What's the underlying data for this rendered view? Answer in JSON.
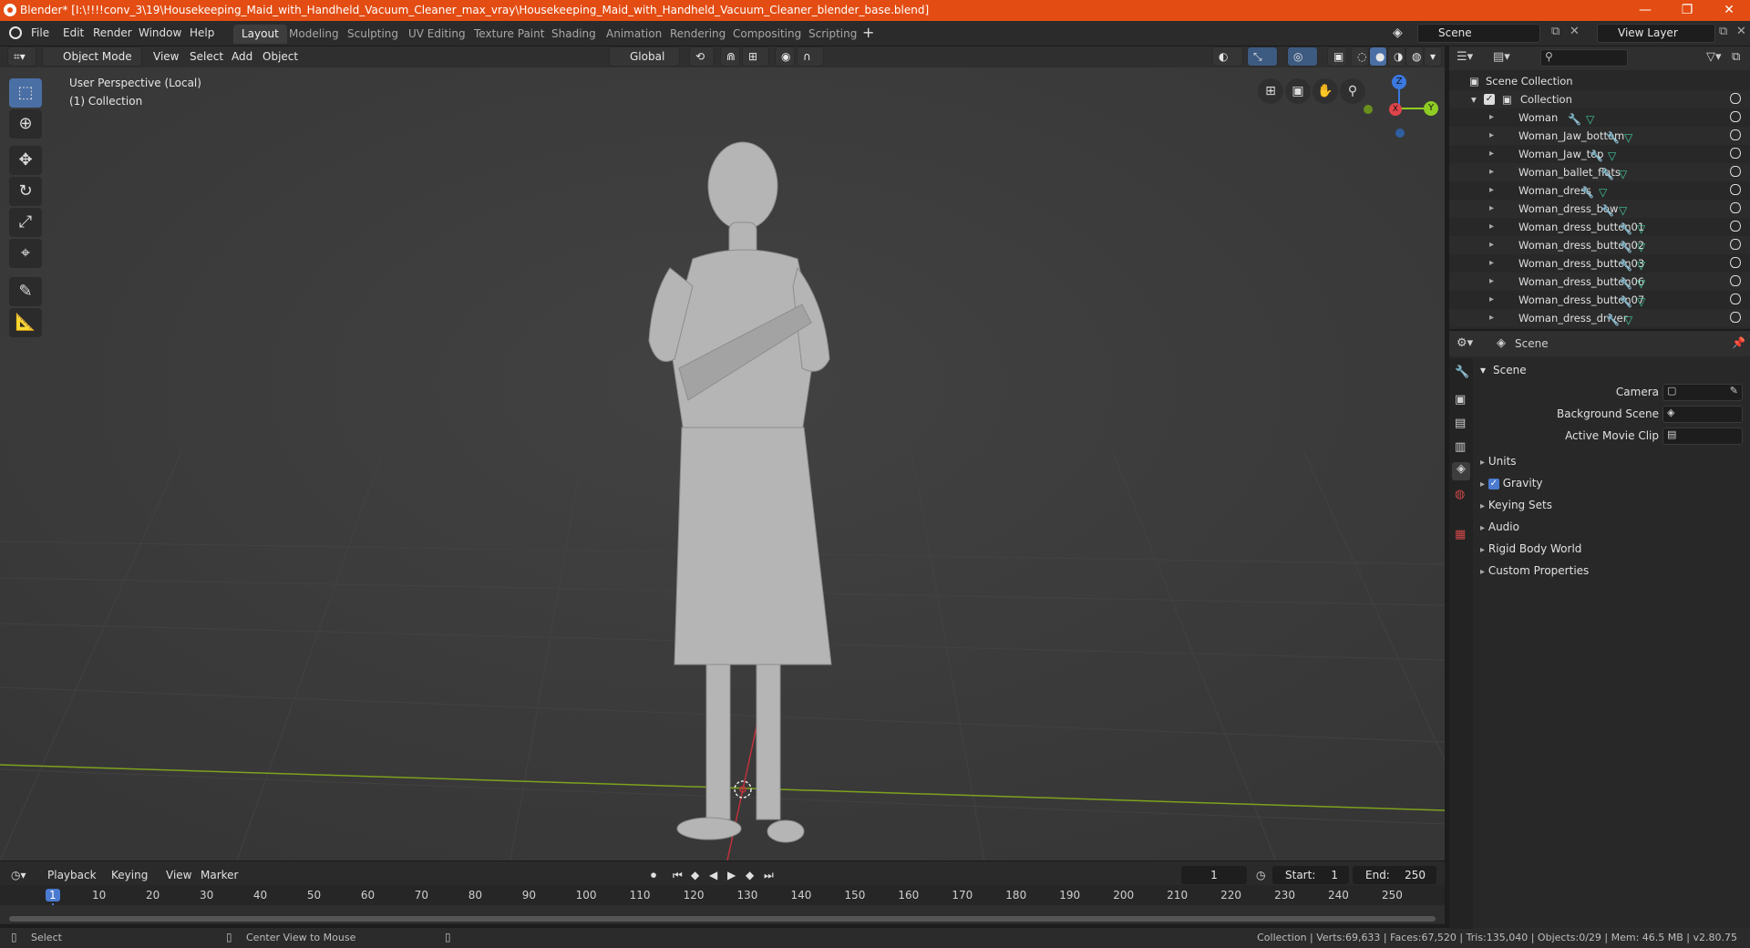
{
  "title_bar": {
    "title": "Blender* [I:\\!!!!conv_3\\19\\Housekeeping_Maid_with_Handheld_Vacuum_Cleaner_max_vray\\Housekeeping_Maid_with_Handheld_Vacuum_Cleaner_blender_base.blend]",
    "controls": [
      "—",
      "❐",
      "✕"
    ]
  },
  "menu_bar": {
    "menus": [
      "File",
      "Edit",
      "Render",
      "Window",
      "Help"
    ],
    "workspaces": [
      "Layout",
      "Modeling",
      "Sculpting",
      "UV Editing",
      "Texture Paint",
      "Shading",
      "Animation",
      "Rendering",
      "Compositing",
      "Scripting"
    ],
    "active_workspace": "Layout",
    "add_tab": "+",
    "scene": "Scene",
    "view_layer": "View Layer"
  },
  "viewport_header": {
    "mode": "Object Mode",
    "menus": [
      "View",
      "Select",
      "Add",
      "Object"
    ],
    "orientation": "Global"
  },
  "viewport": {
    "perspective_label": "User Perspective (Local)",
    "collection_label": "(1) Collection",
    "gizmo": {
      "z": "Z",
      "y": "Y",
      "x": "X"
    }
  },
  "timeline": {
    "menus": [
      "Playback",
      "Keying",
      "View",
      "Marker"
    ],
    "current_frame": "1",
    "start_label": "Start:",
    "start": "1",
    "end_label": "End:",
    "end": "250",
    "ticks": [
      "1",
      "10",
      "20",
      "30",
      "40",
      "50",
      "60",
      "70",
      "80",
      "90",
      "100",
      "110",
      "120",
      "130",
      "140",
      "150",
      "160",
      "170",
      "180",
      "190",
      "200",
      "210",
      "220",
      "230",
      "240",
      "250"
    ]
  },
  "status_bar": {
    "left_action": "Select",
    "middle_action": "Center View to Mouse",
    "stats": "Collection | Verts:69,633 | Faces:67,520 | Tris:135,040 | Objects:0/29 | Mem: 46.5 MB | v2.80.75"
  },
  "outliner": {
    "root": "Scene Collection",
    "collection": "Collection",
    "items": [
      "Woman",
      "Woman_Jaw_bottom",
      "Woman_Jaw_top",
      "Woman_ballet_flats",
      "Woman_dress",
      "Woman_dress_bow",
      "Woman_dress_button01",
      "Woman_dress_button02",
      "Woman_dress_button03",
      "Woman_dress_button06",
      "Woman_dress_button07",
      "Woman_dress_driver"
    ]
  },
  "properties": {
    "context": "Scene",
    "panel": "Scene",
    "fields": [
      {
        "label": "Camera"
      },
      {
        "label": "Background Scene"
      },
      {
        "label": "Active Movie Clip"
      }
    ],
    "subpanels": [
      "Units",
      "Gravity",
      "Keying Sets",
      "Audio",
      "Rigid Body World",
      "Custom Properties"
    ],
    "gravity_checked": true
  },
  "colors": {
    "title_bar": "#e34c12",
    "accent": "#4a7bd0",
    "x_axis": "#e0444b",
    "y_axis": "#8fcc24",
    "z_axis": "#3b78e0",
    "object_icon": "#e08a2a",
    "mesh_icon": "#42c8a0"
  }
}
